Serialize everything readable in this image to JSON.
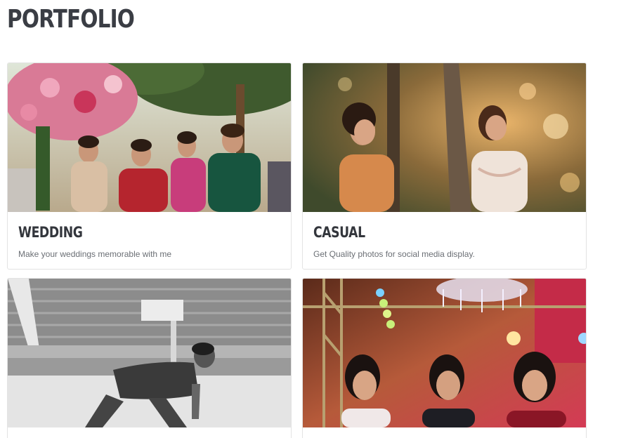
{
  "page": {
    "title": "PORTFOLIO"
  },
  "cards": [
    {
      "title": "WEDDING",
      "text": "Make your weddings memorable with me",
      "image": "wedding-group-photo"
    },
    {
      "title": "CASUAL",
      "text": "Get Quality photos for social media display.",
      "image": "casual-outdoor-photo"
    },
    {
      "title": "",
      "text": "",
      "image": "sports-stadium-bw-photo"
    },
    {
      "title": "",
      "text": "",
      "image": "event-party-photo"
    }
  ]
}
